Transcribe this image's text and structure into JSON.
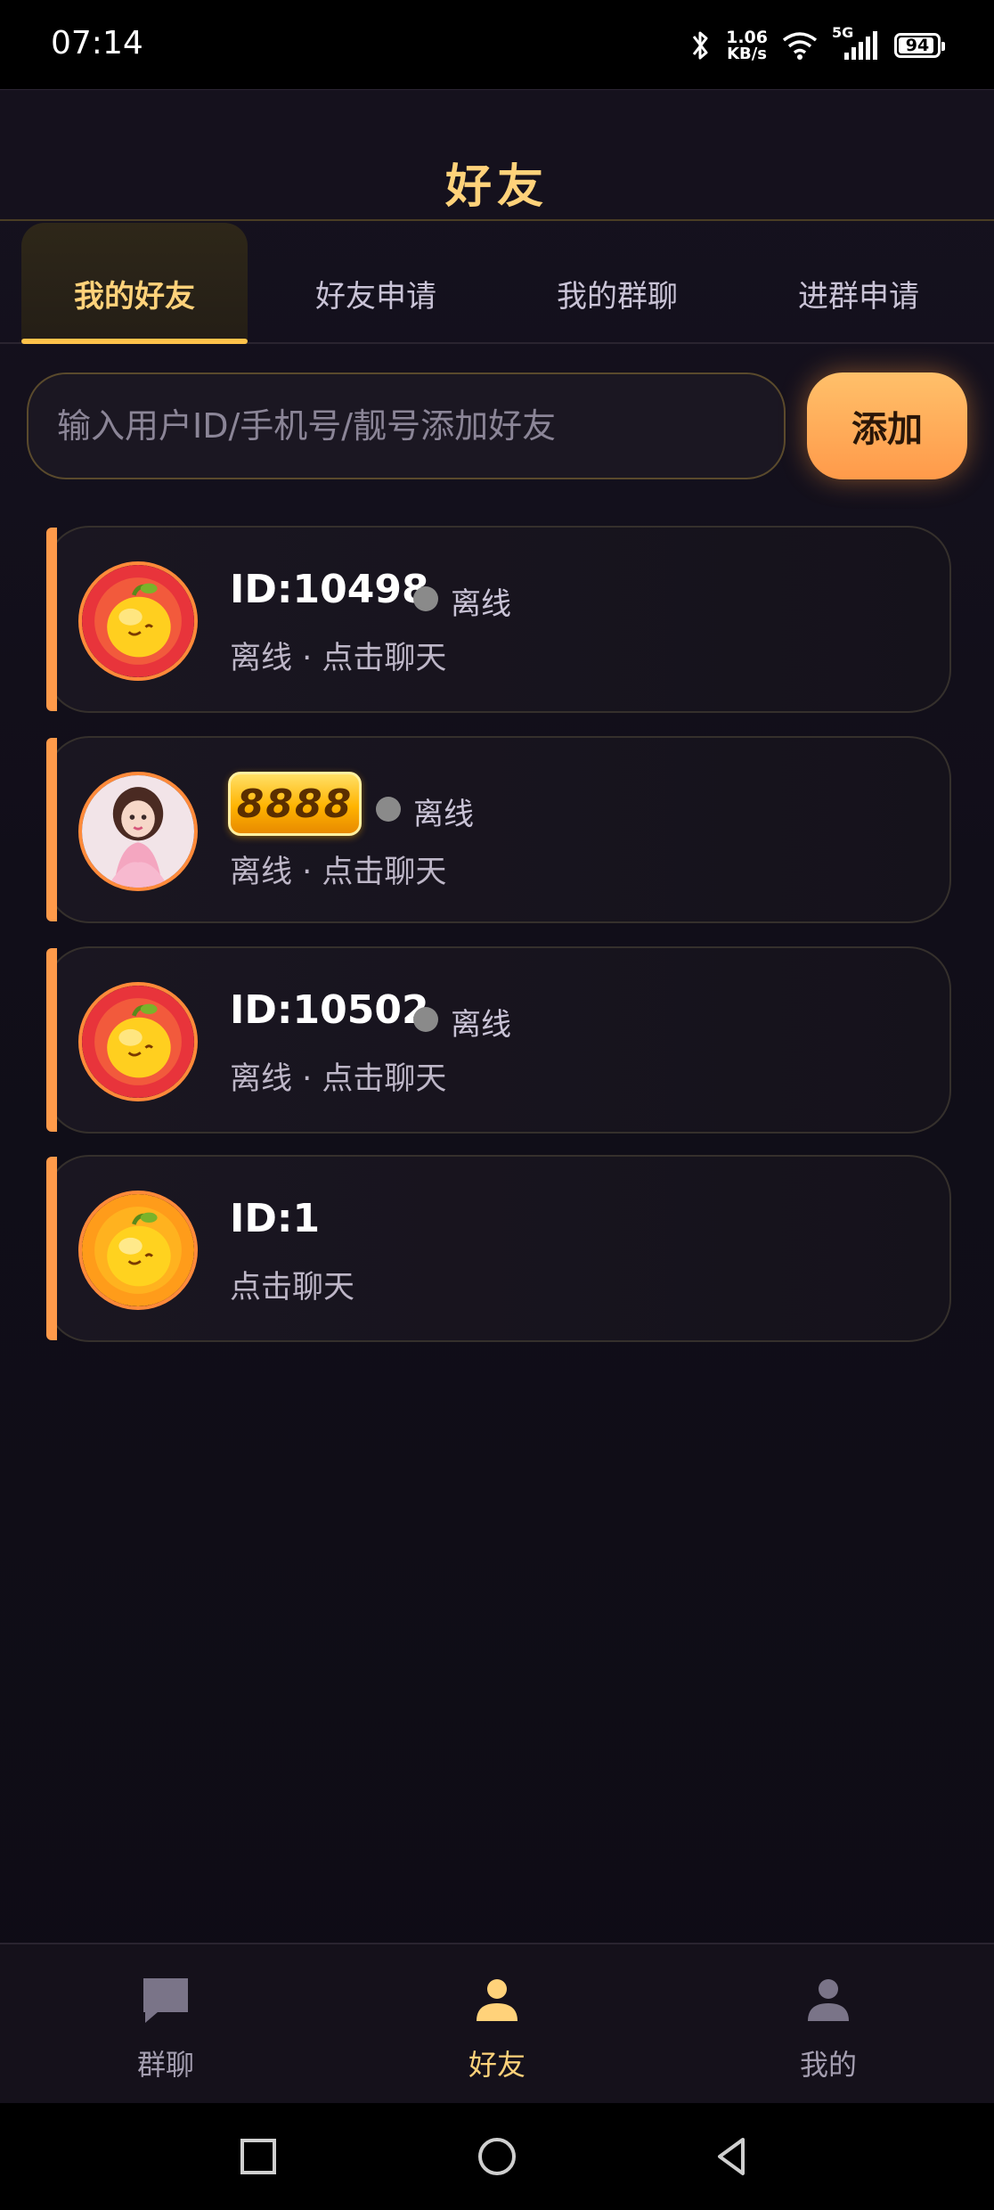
{
  "status_bar": {
    "time": "07:14",
    "net_speed_value": "1.06",
    "net_speed_unit": "KB/s",
    "network_type": "5G",
    "battery": "94",
    "battery_level": 0.94
  },
  "header": {
    "title": "好友"
  },
  "tabs": [
    {
      "label": "我的好友",
      "active": true
    },
    {
      "label": "好友申请",
      "active": false
    },
    {
      "label": "我的群聊",
      "active": false
    },
    {
      "label": "进群申请",
      "active": false
    }
  ],
  "search": {
    "placeholder": "输入用户ID/手机号/靓号添加好友",
    "value": "",
    "add_label": "添加"
  },
  "friends": [
    {
      "name": "ID:10498",
      "status": "离线",
      "subtitle": "离线 · 点击聊天",
      "avatar": "mango-mascot-icon"
    },
    {
      "badge": "8888",
      "status": "离线",
      "subtitle": "离线 · 点击聊天",
      "avatar": "girl-avatar-icon"
    },
    {
      "name": "ID:10502",
      "status": "离线",
      "subtitle": "离线 · 点击聊天",
      "avatar": "mango-mascot-icon"
    },
    {
      "name": "ID:1",
      "subtitle": "点击聊天",
      "avatar": "mango-mascot-icon"
    }
  ],
  "bottom_nav": [
    {
      "label": "群聊",
      "icon": "chat-bubble-icon",
      "active": false
    },
    {
      "label": "好友",
      "icon": "person-icon",
      "active": true
    },
    {
      "label": "我的",
      "icon": "profile-icon",
      "active": false
    }
  ],
  "colors": {
    "accent": "#ffd27a",
    "button": "#ff9a4a",
    "background": "#110e19"
  }
}
